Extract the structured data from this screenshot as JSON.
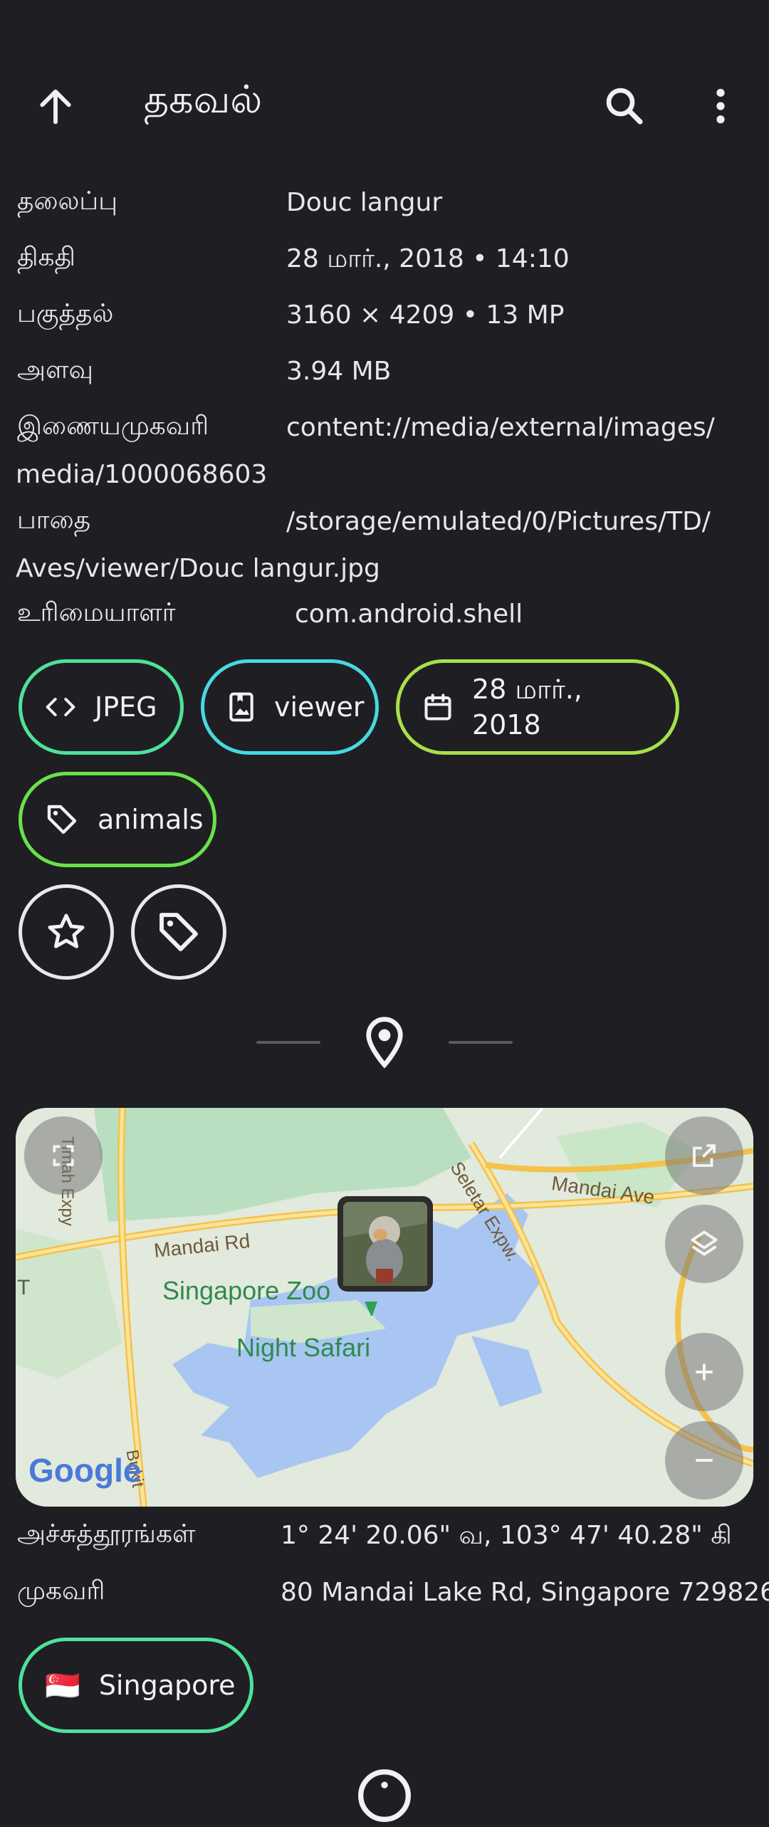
{
  "appbar": {
    "title": "தகவல்",
    "back_icon": "arrow-up-icon",
    "search_icon": "search-icon",
    "more_icon": "more-vert-icon"
  },
  "info_rows": [
    {
      "label": "தலைப்பு",
      "value": "Douc langur"
    },
    {
      "label": "திகதி",
      "value": "28 மார்., 2018 • 14:10"
    },
    {
      "label": "பகுத்தல்",
      "value": "3160 × 4209 • 13 MP"
    },
    {
      "label": "அளவு",
      "value": "3.94 MB"
    },
    {
      "label": "இணையமுகவரி",
      "value": "content://media/external/images/",
      "continuation": "media/1000068603"
    },
    {
      "label": "பாதை",
      "value": "/storage/emulated/0/Pictures/TD/",
      "continuation": "Aves/viewer/Douc langur.jpg"
    },
    {
      "label": "உரிமையாளர்",
      "value": "com.android.shell"
    }
  ],
  "chips": [
    {
      "label": "JPEG",
      "icon": "code-icon",
      "color": "#4ee29a"
    },
    {
      "label": "viewer",
      "icon": "photo-album-icon",
      "color": "#46d9e0"
    },
    {
      "label": "28 மார்., 2018",
      "icon": "calendar-icon",
      "color": "#a9e04a"
    },
    {
      "label": "animals",
      "icon": "tag-icon",
      "color": "#69e24a"
    }
  ],
  "actions": {
    "favorite_icon": "star-outline-icon",
    "tag_icon": "tag-outline-icon"
  },
  "section_icon": "location-pin-icon",
  "map": {
    "labels": {
      "mandai_rd": "Mandai Rd",
      "mandai_ave": "Mandai Ave",
      "seletar": "Seletar Expw.",
      "zoo": "Singapore Zoo",
      "night_safari": "Night Safari",
      "timah": "Timah Expy",
      "bukit": "Bukit",
      "t": "T",
      "google": "Google"
    },
    "buttons": [
      "fullscreen-icon",
      "open-external-icon",
      "layers-icon",
      "zoom-in-icon",
      "zoom-out-icon"
    ]
  },
  "location_rows": [
    {
      "label": "அச்சுத்தூரங்கள்",
      "value": "1° 24' 20.06\" வ, 103° 47' 40.28\" கி"
    },
    {
      "label": "முகவரி",
      "value": "80 Mandai Lake Rd, Singapore 729826"
    }
  ],
  "country_chip": {
    "flag": "🇸🇬",
    "label": "Singapore",
    "color": "#4ee29a"
  },
  "colors": {
    "background": "#1f1f23",
    "text": "#ecebef"
  }
}
